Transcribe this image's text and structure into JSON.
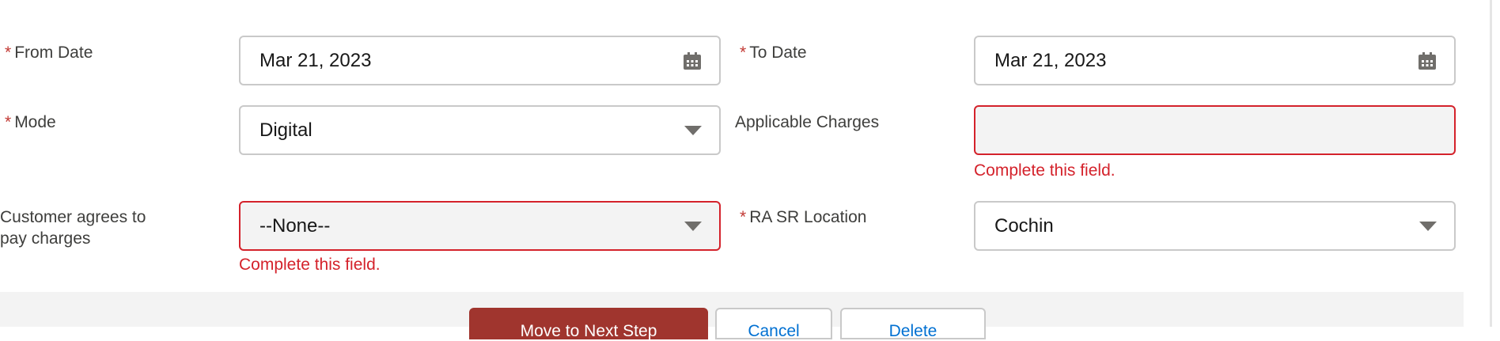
{
  "fields": {
    "from_date": {
      "label": "From Date",
      "required": true,
      "value": "Mar 21, 2023"
    },
    "to_date": {
      "label": "To Date",
      "required": true,
      "value": "Mar 21, 2023"
    },
    "mode": {
      "label": "Mode",
      "required": true,
      "value": "Digital"
    },
    "applicable_charges": {
      "label": "Applicable Charges",
      "value": "",
      "error": "Complete this field."
    },
    "customer_agrees": {
      "label_line1": "Customer agrees to",
      "label_line2": "pay charges",
      "value": "--None--",
      "error": "Complete this field."
    },
    "ra_sr_location": {
      "label": "RA SR Location",
      "required": true,
      "value": "Cochin"
    }
  },
  "required_marker": "*",
  "buttons": {
    "next": "Move to Next Step",
    "cancel": "Cancel",
    "delete": "Delete"
  },
  "colors": {
    "error": "#d4222b",
    "primary": "#a0352e"
  }
}
